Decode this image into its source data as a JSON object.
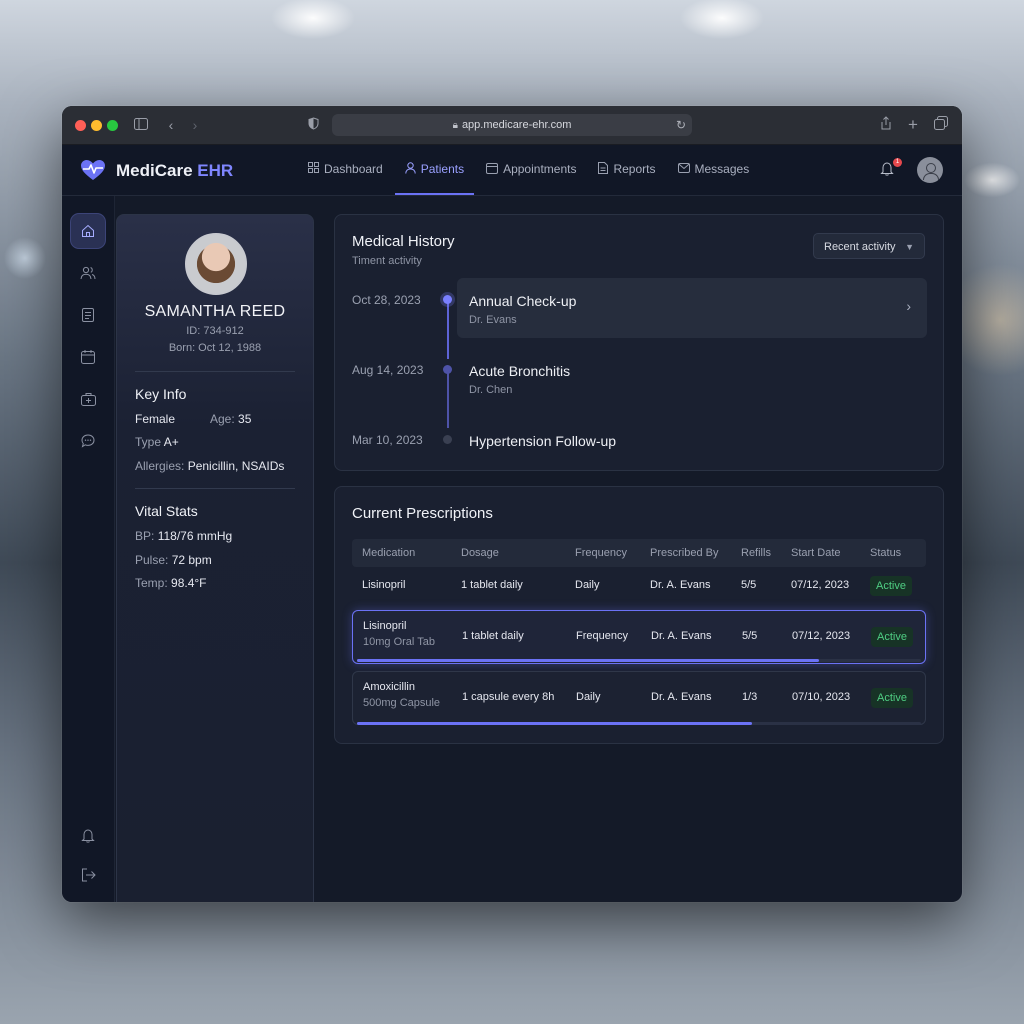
{
  "browser": {
    "url": "app.medicare-ehr.com"
  },
  "app": {
    "brand_main": "MediCare",
    "brand_accent": "EHR",
    "accent_color": "#7f86ff",
    "notification_count": "1"
  },
  "nav": [
    {
      "label": "Dashboard",
      "icon": "grid-icon"
    },
    {
      "label": "Patients",
      "icon": "user-icon"
    },
    {
      "label": "Appointments",
      "icon": "calendar-icon"
    },
    {
      "label": "Reports",
      "icon": "document-icon"
    },
    {
      "label": "Messages",
      "icon": "mail-icon"
    }
  ],
  "patient": {
    "name": "SAMANTHA REED",
    "id": "ID: 734-912",
    "born": "Born: Oct 12, 1988",
    "key_info_title": "Key Info",
    "sex": "Female",
    "age_label": "Age:",
    "age": "35",
    "type_label": "Type",
    "type": "A+",
    "allergies_label": "Allergies:",
    "allergies": "Penicillin, NSAIDs",
    "vitals_title": "Vital Stats",
    "bp_label": "BP:",
    "bp": "118/76 mmHg",
    "pulse_label": "Pulse:",
    "pulse": "72 bpm",
    "temp_label": "Temp:",
    "temp": "98.4°F"
  },
  "history": {
    "title": "Medical History",
    "subtitle": "Timent activity",
    "filter": "Recent activity",
    "events": [
      {
        "date": "Oct 28, 2023",
        "title": "Annual Check-up",
        "doctor": "Dr. Evans"
      },
      {
        "date": "Aug 14, 2023",
        "title": "Acute Bronchitis",
        "doctor": "Dr. Chen"
      },
      {
        "date": "Mar 10, 2023",
        "title": "Hypertension Follow-up",
        "doctor": ""
      }
    ]
  },
  "prescriptions": {
    "title": "Current Prescriptions",
    "columns": [
      "Medication",
      "Dosage",
      "Frequency",
      "Prescribed By",
      "Refills",
      "Start Date",
      "Status"
    ],
    "rows": [
      {
        "medication": "Lisinopril",
        "detail": "",
        "dosage": "1 tablet daily",
        "frequency": "Daily",
        "prescriber": "Dr. A. Evans",
        "refills": "5/5",
        "start": "07/12, 2023",
        "status": "Active",
        "progress": null
      },
      {
        "medication": "Lisinopril",
        "detail": "10mg Oral Tab",
        "dosage": "1 tablet daily",
        "frequency": "Frequency",
        "prescriber": "Dr. A. Evans",
        "refills": "5/5",
        "start": "07/12, 2023",
        "status": "Active",
        "progress": 0.82
      },
      {
        "medication": "Amoxicillin",
        "detail": "500mg Capsule",
        "dosage": "1 capsule every 8h",
        "frequency": "Daily",
        "prescriber": "Dr. A. Evans",
        "refills": "1/3",
        "start": "07/10, 2023",
        "status": "Active",
        "progress": 0.7
      }
    ]
  }
}
